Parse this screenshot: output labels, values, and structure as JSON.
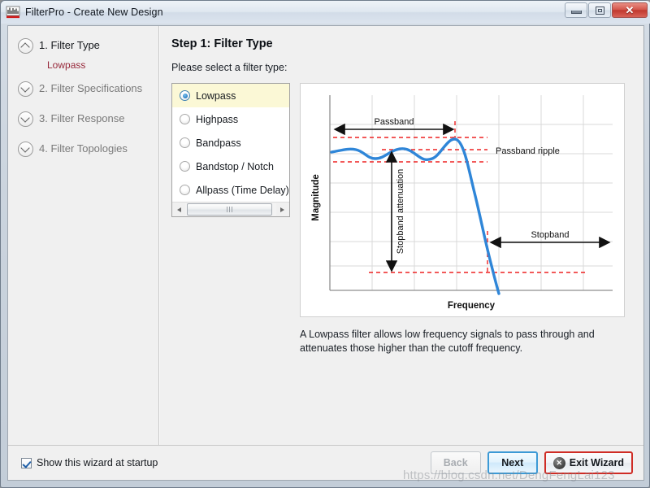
{
  "window": {
    "title": "FilterPro - Create New Design",
    "app_icon": "waveform-icon",
    "minimize_label": "Minimize",
    "maximize_label": "Maximize",
    "close_label": "Close",
    "close_glyph": "✕"
  },
  "sidebar": {
    "steps": [
      {
        "label": "1. Filter Type",
        "chevron": "chevron-up-icon",
        "active": true,
        "sub": "Lowpass"
      },
      {
        "label": "2. Filter Specifications",
        "chevron": "chevron-down-icon",
        "active": false
      },
      {
        "label": "3. Filter Response",
        "chevron": "chevron-down-icon",
        "active": false
      },
      {
        "label": "4. Filter Topologies",
        "chevron": "chevron-down-icon",
        "active": false
      }
    ]
  },
  "main": {
    "step_title": "Step 1: Filter Type",
    "instruction": "Please select a filter type:",
    "filter_types": [
      {
        "label": "Lowpass",
        "selected": true
      },
      {
        "label": "Highpass",
        "selected": false
      },
      {
        "label": "Bandpass",
        "selected": false
      },
      {
        "label": "Bandstop / Notch",
        "selected": false
      },
      {
        "label": "Allpass (Time Delay)",
        "selected": false
      }
    ],
    "description": "A Lowpass filter allows low frequency signals to pass through and attenuates those higher than the cutoff frequency."
  },
  "chart_data": {
    "type": "line",
    "title": "",
    "xlabel": "Frequency",
    "ylabel": "Magnitude",
    "xlim": [
      0,
      100
    ],
    "ylim": [
      0,
      100
    ],
    "grid": true,
    "legend": false,
    "curve_color": "#2f86d8",
    "guide_color": "#ee2222",
    "annotation_color": "#111111",
    "series": [
      {
        "name": "Lowpass magnitude response",
        "points": [
          [
            0,
            78
          ],
          [
            4,
            79
          ],
          [
            8,
            80
          ],
          [
            12,
            78
          ],
          [
            16,
            75
          ],
          [
            20,
            74
          ],
          [
            24,
            76
          ],
          [
            28,
            79
          ],
          [
            32,
            80
          ],
          [
            36,
            78
          ],
          [
            40,
            75
          ],
          [
            44,
            74
          ],
          [
            48,
            76
          ],
          [
            52,
            80
          ],
          [
            56,
            84
          ],
          [
            60,
            85
          ],
          [
            63,
            83
          ],
          [
            66,
            76
          ],
          [
            69,
            66
          ],
          [
            72,
            54
          ],
          [
            75,
            42
          ],
          [
            78,
            30
          ],
          [
            81,
            18
          ],
          [
            84,
            8
          ],
          [
            86,
            1
          ]
        ]
      }
    ],
    "guides": [
      {
        "name": "passband-ripple-upper",
        "type": "hline",
        "y": 84,
        "x0": 2,
        "x1": 78
      },
      {
        "name": "passband-ripple-lower",
        "type": "hline",
        "y": 74,
        "x0": 2,
        "x1": 78
      },
      {
        "name": "passband-nominal",
        "type": "hline",
        "y": 79,
        "x0": 18,
        "x1": 66
      },
      {
        "name": "cutoff-vertical",
        "type": "vline",
        "x": 63,
        "y0": 60,
        "y1": 92
      },
      {
        "name": "stopband-start-vertical",
        "type": "vline",
        "x": 75,
        "y0": 10,
        "y1": 38
      },
      {
        "name": "stopband-floor",
        "type": "hline",
        "y": 10,
        "x0": 20,
        "x1": 93
      }
    ],
    "annotations": [
      {
        "name": "passband-arrow",
        "label": "Passband",
        "type": "double-arrow-horizontal",
        "x0": 2,
        "x1": 63,
        "y": 89
      },
      {
        "name": "passband-ripple-label",
        "label": "Passband ripple",
        "type": "text",
        "x": 80,
        "y": 79
      },
      {
        "name": "stopband-attenuation-arrow",
        "label": "Stopband attenuation",
        "type": "double-arrow-vertical",
        "x": 24,
        "y0": 10,
        "y1": 76,
        "rotated": true
      },
      {
        "name": "stopband-arrow",
        "label": "Stopband",
        "type": "double-arrow-horizontal",
        "x0": 75,
        "x1": 100,
        "y": 32
      }
    ]
  },
  "bottom": {
    "startup_checkbox_label": "Show this wizard at startup",
    "startup_checkbox_checked": true,
    "back_label": "Back",
    "back_disabled": true,
    "next_label": "Next",
    "exit_label": "Exit Wizard",
    "exit_icon": "exit-circle-icon"
  },
  "watermark": "https://blog.csdn.net/DengFengLai123"
}
